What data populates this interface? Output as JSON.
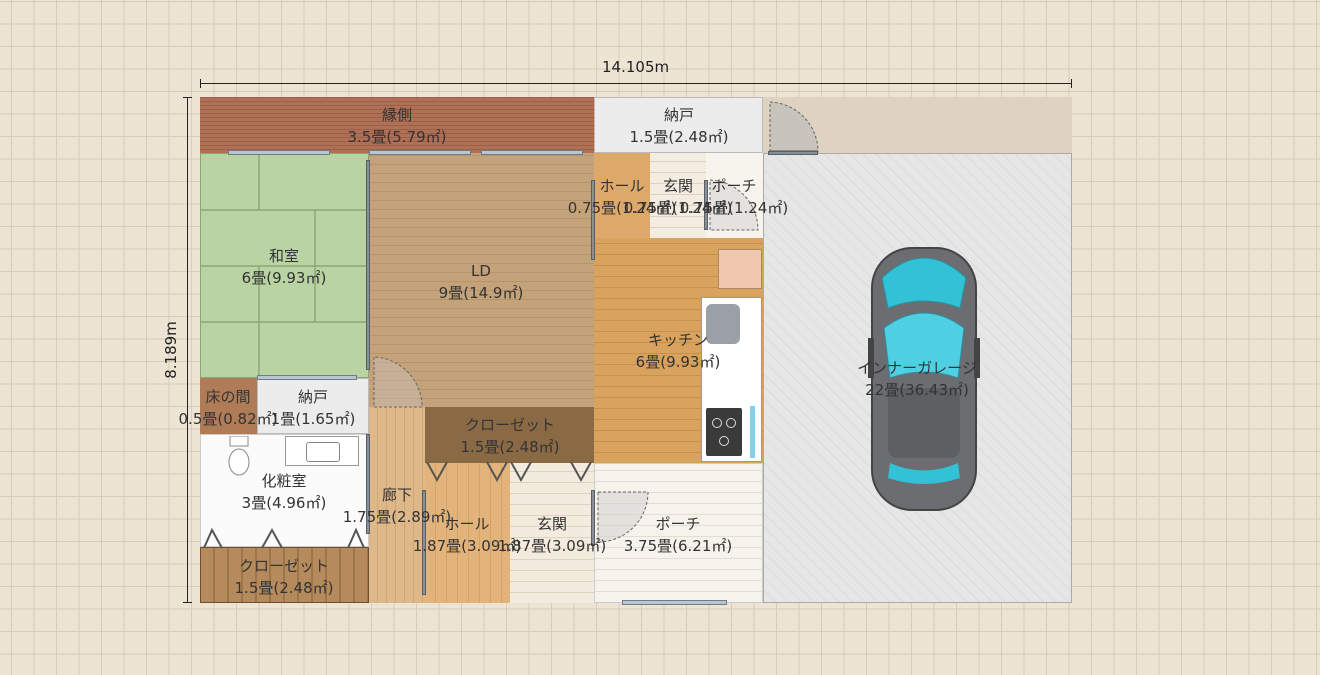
{
  "dimensions": {
    "width_label": "14.105m",
    "height_label": "8.189m"
  },
  "rooms": [
    {
      "name": "縁側",
      "area": "3.5畳(5.79㎡)"
    },
    {
      "name": "納戸",
      "area": "1.5畳(2.48㎡)"
    },
    {
      "name": "和室",
      "area": "6畳(9.93㎡)"
    },
    {
      "name": "LD",
      "area": "9畳(14.9㎡)"
    },
    {
      "name": "ホール",
      "area": "0.75畳(1.24㎡)"
    },
    {
      "name": "玄関",
      "area": "0.75畳(1.24㎡)"
    },
    {
      "name": "ポーチ",
      "area": "0.75畳(1.24㎡)"
    },
    {
      "name": "キッチン",
      "area": "6畳(9.93㎡)"
    },
    {
      "name": "インナーガレージ",
      "area": "22畳(36.43㎡)"
    },
    {
      "name": "床の間",
      "area": "0.5畳(0.82㎡)"
    },
    {
      "name": "納戸",
      "area": "1畳(1.65㎡)"
    },
    {
      "name": "クローゼット",
      "area": "1.5畳(2.48㎡)"
    },
    {
      "name": "化粧室",
      "area": "3畳(4.96㎡)"
    },
    {
      "name": "廊下",
      "area": "1.75畳(2.89㎡)"
    },
    {
      "name": "ホール",
      "area": "1.87畳(3.09㎡)"
    },
    {
      "name": "玄関",
      "area": "1.87畳(3.09㎡)"
    },
    {
      "name": "ポーチ",
      "area": "3.75畳(6.21㎡)"
    },
    {
      "name": "クローゼット",
      "area": "1.5畳(2.48㎡)"
    }
  ]
}
